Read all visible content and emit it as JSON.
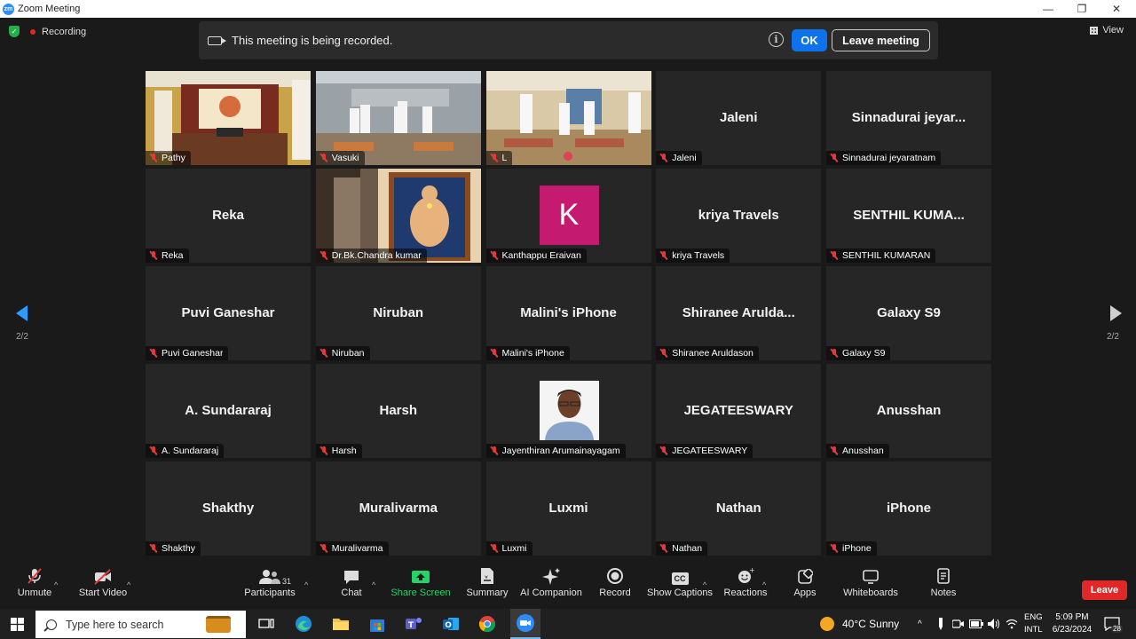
{
  "window": {
    "title": "Zoom Meeting",
    "logo": "zm"
  },
  "top": {
    "recording_label": "Recording",
    "view_label": "View"
  },
  "banner": {
    "message": "This meeting is being recorded.",
    "info": "i",
    "ok_label": "OK",
    "leave_label": "Leave meeting"
  },
  "nav": {
    "page_left": "2/2",
    "page_right": "2/2"
  },
  "tiles": [
    {
      "big": "",
      "name": "Pathy",
      "kind": "video-room"
    },
    {
      "big": "",
      "name": "Vasuki",
      "kind": "video-yoga1"
    },
    {
      "big": "",
      "name": "L",
      "kind": "video-yoga2"
    },
    {
      "big": "Jaleni",
      "name": "Jaleni"
    },
    {
      "big": "Sinnadurai  jeyar...",
      "name": "Sinnadurai jeyaratnam"
    },
    {
      "big": "Reka",
      "name": "Reka"
    },
    {
      "big": "",
      "name": "Dr.Bk.Chandra kumar",
      "kind": "video-portrait"
    },
    {
      "big": "",
      "name": "Kanthappu Eraivan",
      "kind": "avatar-letter",
      "letter": "K"
    },
    {
      "big": "kriya Travels",
      "name": "kriya Travels"
    },
    {
      "big": "SENTHIL  KUMA...",
      "name": "SENTHIL KUMARAN"
    },
    {
      "big": "Puvi Ganeshar",
      "name": "Puvi Ganeshar"
    },
    {
      "big": "Niruban",
      "name": "Niruban"
    },
    {
      "big": "Malini's iPhone",
      "name": "Malini's iPhone"
    },
    {
      "big": "Shiranee  Arulda...",
      "name": "Shiranee Aruldason"
    },
    {
      "big": "Galaxy S9",
      "name": "Galaxy S9"
    },
    {
      "big": "A. Sundararaj",
      "name": "A. Sundararaj"
    },
    {
      "big": "Harsh",
      "name": "Harsh"
    },
    {
      "big": "",
      "name": "Jayenthiran Arumainayagam",
      "kind": "avatar-photo"
    },
    {
      "big": "JEGATEESWARY",
      "name": "JEGATEESWARY"
    },
    {
      "big": "Anusshan",
      "name": "Anusshan"
    },
    {
      "big": "Shakthy",
      "name": "Shakthy"
    },
    {
      "big": "Muralivarma",
      "name": "Muralivarma"
    },
    {
      "big": "Luxmi",
      "name": "Luxmi"
    },
    {
      "big": "Nathan",
      "name": "Nathan"
    },
    {
      "big": "iPhone",
      "name": "iPhone"
    }
  ],
  "toolbar": {
    "unmute": "Unmute",
    "start_video": "Start Video",
    "participants": "Participants",
    "participants_count": "31",
    "chat": "Chat",
    "share_screen": "Share Screen",
    "summary": "Summary",
    "ai_companion": "AI Companion",
    "record": "Record",
    "show_captions": "Show Captions",
    "captions_icon_text": "CC",
    "reactions": "Reactions",
    "apps": "Apps",
    "whiteboards": "Whiteboards",
    "notes": "Notes",
    "leave": "Leave"
  },
  "taskbar": {
    "search_placeholder": "Type here to search",
    "weather": "40°C  Sunny",
    "lang_top": "ENG",
    "lang_bottom": "INTL",
    "time": "5:09 PM",
    "date": "6/23/2024",
    "notifications": "28"
  },
  "colors": {
    "accent": "#0e72ed",
    "leave_red": "#e02828",
    "share_green": "#25d366",
    "avatar_k": "#c41a6f"
  }
}
